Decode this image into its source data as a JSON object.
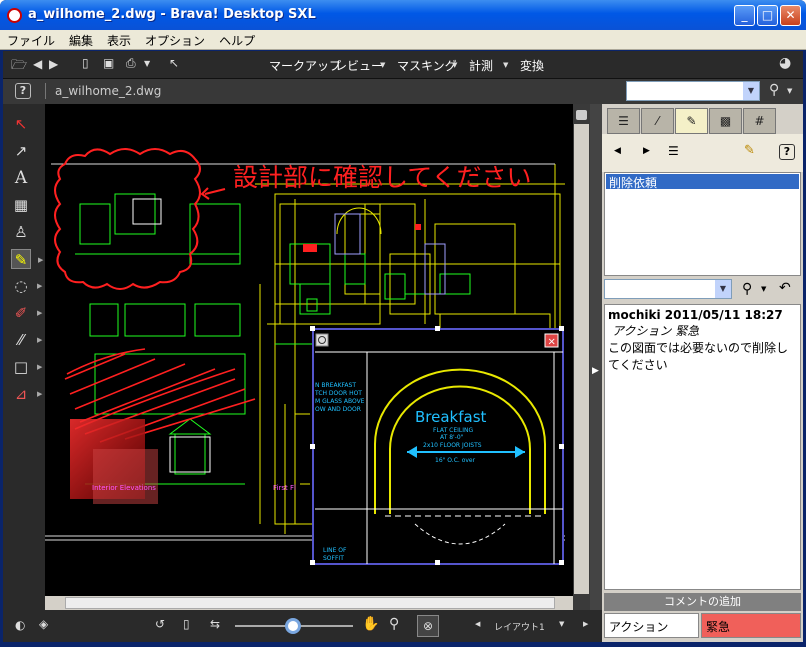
{
  "window": {
    "title": "a_wilhome_2.dwg - Brava! Desktop SXL"
  },
  "menubar": {
    "items": [
      "ファイル",
      "編集",
      "表示",
      "オプション",
      "ヘルプ"
    ]
  },
  "toolbar": {
    "menus": [
      "マークアップ",
      "レビュー",
      "マスキング",
      "計測",
      "変換"
    ]
  },
  "toolbar2": {
    "tab_name": "a_wilhome_2.dwg",
    "help": "?"
  },
  "drawing": {
    "annotation_text": "設計部に確認してください",
    "breakfast": "Breakfast",
    "flat_ceiling": "FLAT CEILING",
    "at_height": "AT 8'-0\"",
    "joists": "2x10 FLOOR JOISTS",
    "oc": "16\" O.C. over",
    "left_note1": "N BREAKFAST",
    "left_note2": "TCH DOOR HOT",
    "left_note3": "M GLASS ABOVE",
    "left_note4": "OW AND DOOR",
    "line_of": "LINE OF",
    "soffit": "SOFFIT",
    "interior_elevations": "Interior Elevations",
    "first_floor": "First Fl"
  },
  "panel": {
    "selected_item": "削除依頼",
    "comment_author": "mochiki 2011/05/11 18:27",
    "comment_tags": "アクション 緊急",
    "comment_body": "この図面では必要ないので削除してください",
    "add_comment": "コメントの追加",
    "tag_action": "アクション",
    "tag_urgent": "緊急",
    "help": "?"
  },
  "bottombar": {
    "layout": "レイアウト1"
  },
  "colors": {
    "urgent": "#f0605a",
    "selected": "#316ac5",
    "markup": "#ff2020"
  }
}
